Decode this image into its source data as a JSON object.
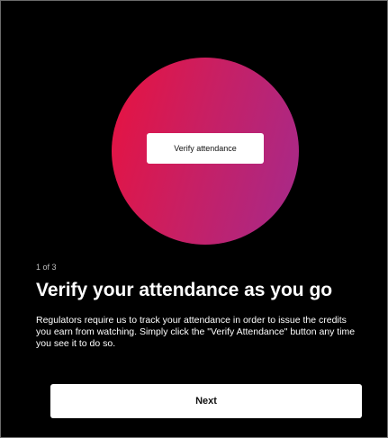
{
  "onboarding": {
    "hero_button_label": "Verify attendance",
    "step_counter": "1 of 3",
    "title": "Verify your attendance as you go",
    "body": "Regulators require us to track your attendance in order to issue the credits you earn from watching. Simply click the \"Verify Attendance\" button any time you see it to do so.",
    "next_label": "Next"
  },
  "colors": {
    "background": "#000000",
    "gradient_start": "#e8123f",
    "gradient_end": "#a52a8c",
    "button_bg": "#ffffff"
  }
}
